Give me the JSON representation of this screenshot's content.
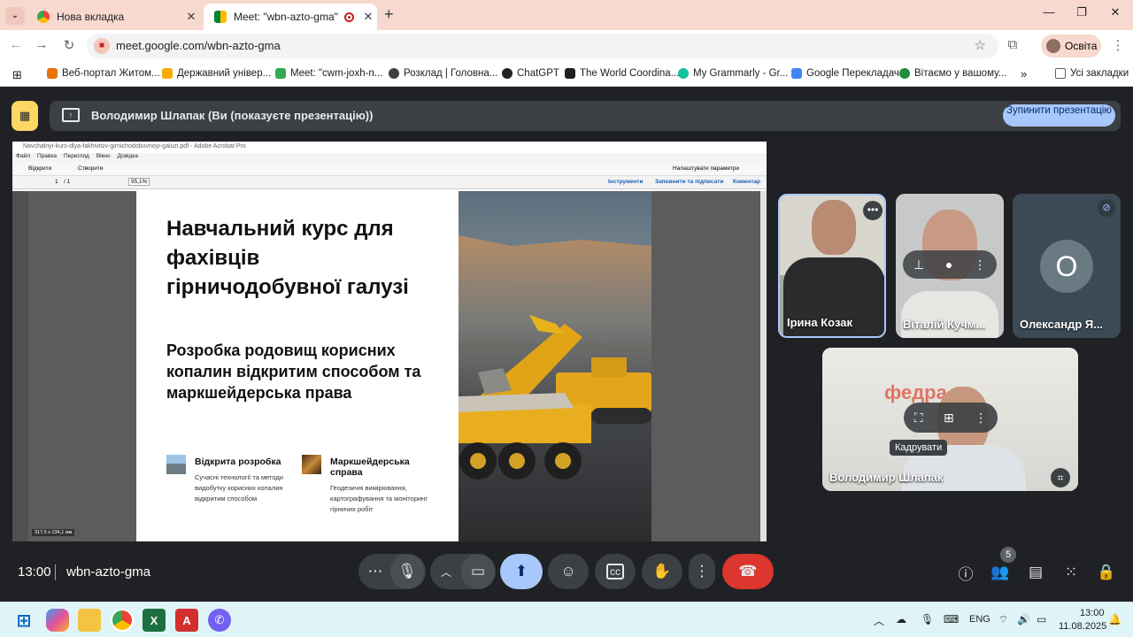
{
  "browser": {
    "tabs": [
      {
        "label": "Нова вкладка"
      },
      {
        "label": "Meet: \"wbn-azto-gma\""
      }
    ],
    "close_glyph": "✕",
    "new_tab_glyph": "+",
    "url": "meet.google.com/wbn-azto-gma",
    "profile_label": "Освіта",
    "bookmarks": [
      {
        "label": "Веб-портал Житом...",
        "color": "#e8710a"
      },
      {
        "label": "Державний універ...",
        "color": "#f9ab00"
      },
      {
        "label": "Meet: \"cwm-joxh-n...",
        "color": "#34a853"
      },
      {
        "label": "Розклад | Головна...",
        "color": "#3c4043"
      },
      {
        "label": "ChatGPT",
        "color": "#202124"
      },
      {
        "label": "The World Coordina...",
        "color": "#202124"
      },
      {
        "label": "My Grammarly - Gr...",
        "color": "#15c39a"
      },
      {
        "label": "Google Перекладач",
        "color": "#4285f4"
      },
      {
        "label": "Вітаємо у вашому...",
        "color": "#1e8e3e"
      }
    ],
    "all_bookmarks_label": "Усі закладки"
  },
  "meet": {
    "presenting_text": "Володимир Шлапак (Ви (показуєте презентацію))",
    "stop_presenting_label": "Зупинити презентацію",
    "time": "13:00",
    "meeting_code": "wbn-azto-gma",
    "participants_count": "5",
    "tooltip": "Кадрувати",
    "participants": [
      {
        "name": "Ірина Козак"
      },
      {
        "name": "Віталій Кучм..."
      },
      {
        "name": "Олександр Я...",
        "initial": "О"
      },
      {
        "name": "Володимир Шлапак"
      }
    ]
  },
  "acrobat": {
    "title": "Navchalnyi-kurs-dlya-fakhivtsiv-girnichodobuvnoyi-galuzi.pdf - Adobe Acrobat Pro",
    "menu": [
      "Файл",
      "Правка",
      "Перегляд",
      "Вікно",
      "Довідка"
    ],
    "open_label": "Відкрити",
    "create_label": "Створити",
    "customize_label": "Налаштувати параметри",
    "page": "1",
    "page_total": "/ 1",
    "zoom": "95,1%",
    "tools_label": "Інструменти",
    "fill_sign_label": "Заповнити та підписати",
    "comment_label": "Коментар",
    "page_size": "317,5 x 234,1 мм"
  },
  "slide": {
    "title": "Навчальний курс для фахівців гірничодобувної галузі",
    "subtitle": "Розробка родовищ корисних копалин відкритим способом та маркшейдерська права",
    "features": [
      {
        "title": "Відкрита розробка",
        "desc": "Сучасні технології та методи видобутку корисних копалин відкритим способом"
      },
      {
        "title": "Маркшейдерська справа",
        "desc": "Геодезичні вимірювання, картографування та моніторинг гірничих робіт"
      }
    ]
  },
  "taskbar": {
    "lang": "ENG",
    "time": "13:00",
    "date": "11.08.2025"
  }
}
